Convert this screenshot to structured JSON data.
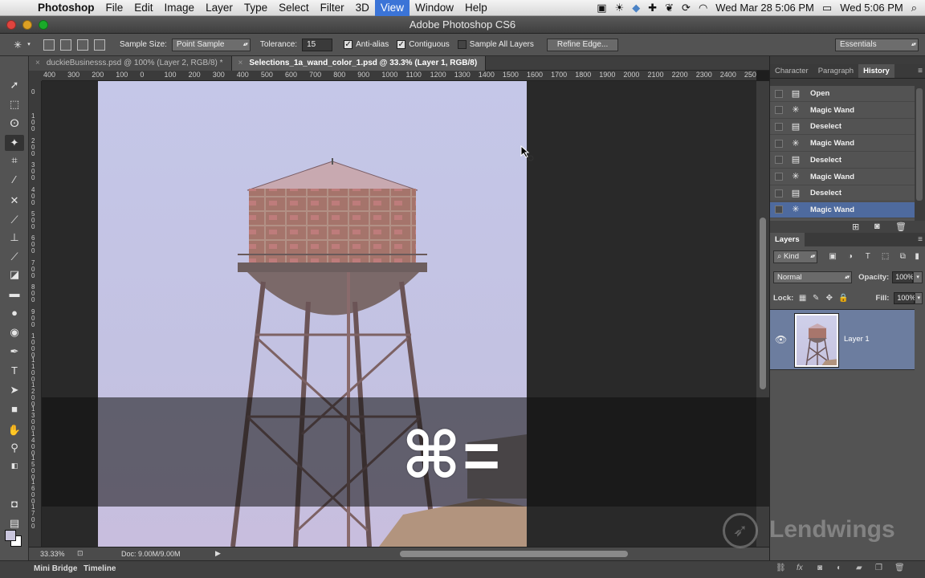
{
  "menubar": {
    "items": [
      "Photoshop",
      "File",
      "Edit",
      "Image",
      "Layer",
      "Type",
      "Select",
      "Filter",
      "3D",
      "View",
      "Window",
      "Help"
    ],
    "active": "View",
    "clock_left": "Wed Mar 28  5:06 PM",
    "clock_right": "Wed 5:06 PM"
  },
  "window": {
    "title": "Adobe Photoshop CS6"
  },
  "options": {
    "sample_size_label": "Sample Size:",
    "sample_size_value": "Point Sample",
    "tolerance_label": "Tolerance:",
    "tolerance_value": "15",
    "anti_alias": "Anti-alias",
    "contiguous": "Contiguous",
    "sample_all_layers": "Sample All Layers",
    "refine_edge": "Refine Edge...",
    "workspace": "Essentials"
  },
  "tabs": [
    {
      "label": "duckieBusinesss.psd @ 100% (Layer 2, RGB/8) *"
    },
    {
      "label": "Selections_1a_wand_color_1.psd @ 33.3% (Layer 1, RGB/8)"
    }
  ],
  "ruler": {
    "h_ticks": [
      "400",
      "300",
      "200",
      "100",
      "0",
      "100",
      "200",
      "300",
      "400",
      "500",
      "600",
      "700",
      "800",
      "900",
      "1000",
      "1100",
      "1200",
      "1300",
      "1400",
      "1500",
      "1600",
      "1700",
      "1800",
      "1900",
      "2000",
      "2100",
      "2200",
      "2300",
      "2400",
      "2500"
    ],
    "v_ticks": [
      "0",
      "100",
      "200",
      "300",
      "400",
      "500",
      "600",
      "700",
      "800",
      "900",
      "1000",
      "1100",
      "1200",
      "1300",
      "1400",
      "1500",
      "1600",
      "1700"
    ]
  },
  "status": {
    "zoom": "33.33%",
    "doc": "Doc: 9.00M/9.00M"
  },
  "bottom_tabs": [
    "Mini Bridge",
    "Timeline"
  ],
  "panels": {
    "top_tabs": [
      "Character",
      "Paragraph",
      "History"
    ],
    "history": [
      "Open",
      "Magic Wand",
      "Deselect",
      "Magic Wand",
      "Deselect",
      "Magic Wand",
      "Deselect",
      "Magic Wand"
    ],
    "layers_tab": "Layers",
    "kind": "Kind",
    "blend_mode": "Normal",
    "opacity_label": "Opacity:",
    "opacity_value": "100%",
    "lock_label": "Lock:",
    "fill_label": "Fill:",
    "fill_value": "100%",
    "layer_name": "Layer 1"
  },
  "overlay": {
    "shortcut": "⌘="
  },
  "watermark": "Lendwings"
}
